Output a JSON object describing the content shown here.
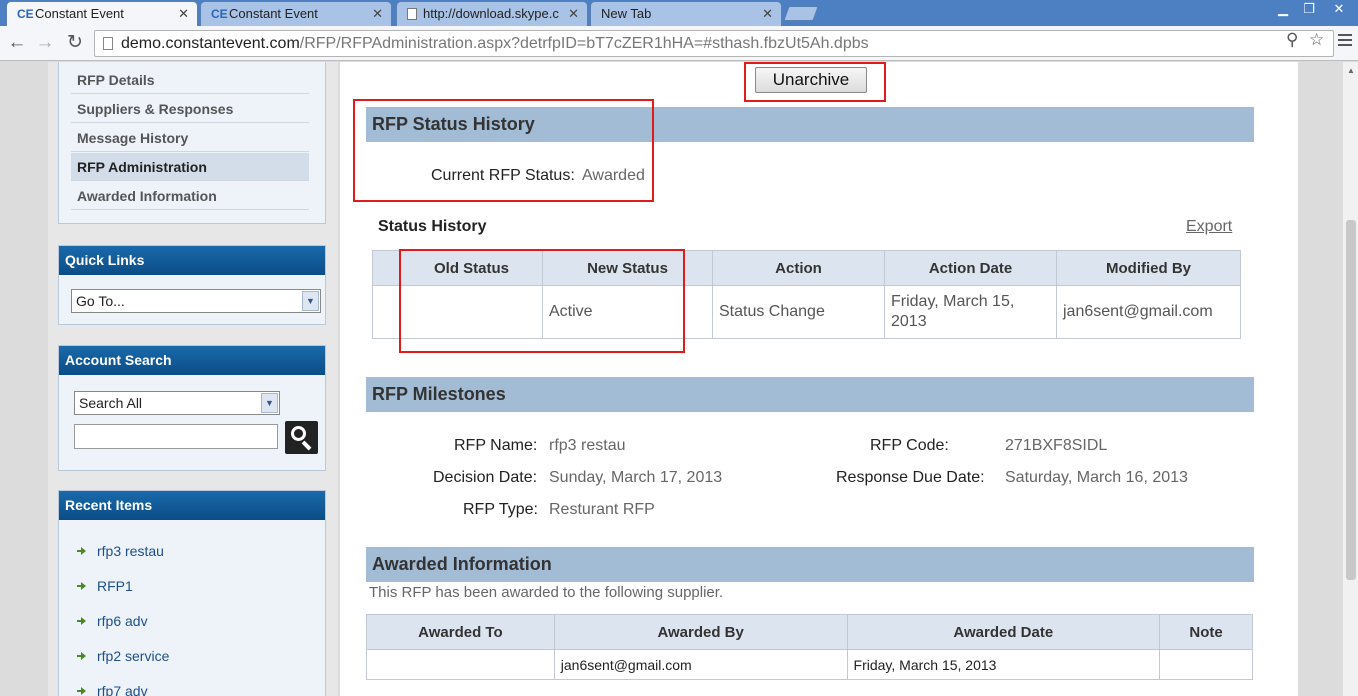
{
  "browser": {
    "tabs": [
      {
        "icon": "CE",
        "title": "Constant Event",
        "active": true
      },
      {
        "icon": "CE",
        "title": "Constant Event",
        "active": false
      },
      {
        "icon": "page",
        "title": "http://download.skype.c",
        "active": false
      },
      {
        "icon": "",
        "title": "New Tab",
        "active": false
      }
    ],
    "url_host": "demo.constantevent.com",
    "url_path": "/RFP/RFPAdministration.aspx?detrfpID=bT7cZER1hHA=#sthash.fbzUt5Ah.dpbs"
  },
  "sidebar": {
    "subnav": [
      "RFP Details",
      "Suppliers & Responses",
      "Message History",
      "RFP Administration",
      "Awarded Information"
    ],
    "active_subnav": "RFP Administration",
    "quick_links": {
      "title": "Quick Links",
      "select_value": "Go To..."
    },
    "account_search": {
      "title": "Account Search",
      "select_value": "Search All",
      "input_value": ""
    },
    "recent_items": {
      "title": "Recent Items",
      "items": [
        "rfp3 restau",
        "RFP1",
        "rfp6 adv",
        "rfp2 service",
        "rfp7 adv"
      ]
    }
  },
  "main": {
    "unarchive_label": "Unarchive",
    "status_history_section": {
      "title": "RFP Status History",
      "current_status_label": "Current RFP Status:",
      "current_status_value": "Awarded",
      "subtitle": "Status History",
      "export_label": "Export",
      "columns": [
        "",
        "Old Status",
        "New Status",
        "Action",
        "Action Date",
        "Modified By"
      ],
      "rows": [
        {
          "old_status": "",
          "new_status": "Active",
          "action": "Status Change",
          "action_date": "Friday, March 15, 2013",
          "modified_by": "jan6sent@gmail.com"
        }
      ]
    },
    "milestones": {
      "title": "RFP Milestones",
      "rfp_name_label": "RFP Name:",
      "rfp_name": "rfp3 restau",
      "rfp_code_label": "RFP Code:",
      "rfp_code": "271BXF8SIDL",
      "decision_date_label": "Decision Date:",
      "decision_date": "Sunday, March 17, 2013",
      "response_due_label": "Response Due Date:",
      "response_due": "Saturday, March 16, 2013",
      "rfp_type_label": "RFP Type:",
      "rfp_type": "Resturant RFP"
    },
    "awarded": {
      "title": "Awarded Information",
      "intro": "This RFP has been awarded to the following supplier.",
      "columns": [
        "Awarded To",
        "Awarded By",
        "Awarded Date",
        "Note"
      ],
      "rows": [
        {
          "awarded_to": "",
          "awarded_by": "jan6sent@gmail.com",
          "awarded_date": "Friday, March 15, 2013",
          "note": ""
        }
      ]
    }
  }
}
